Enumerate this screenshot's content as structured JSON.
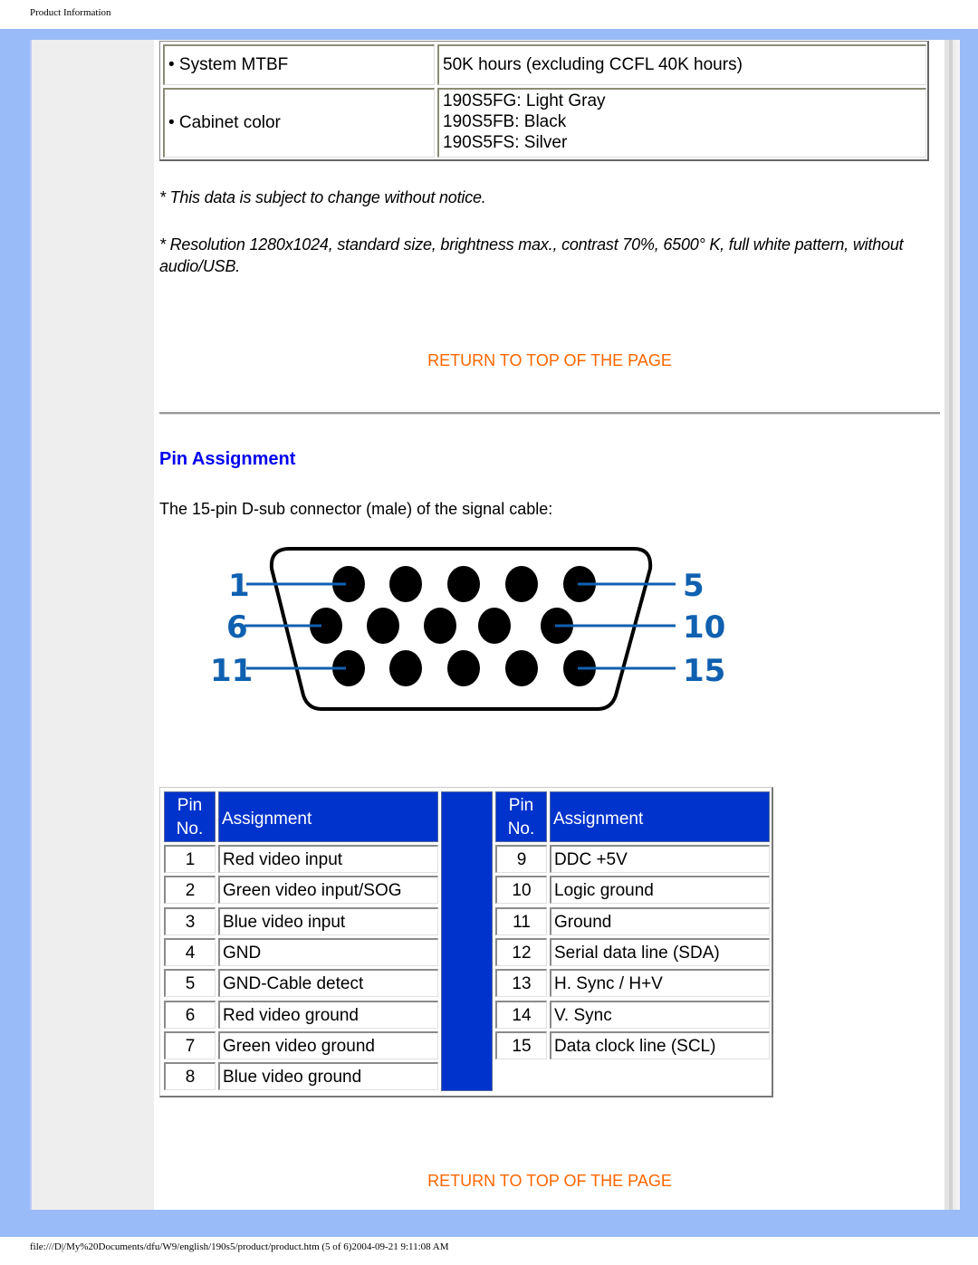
{
  "print_header": "Product Information",
  "spec_rows": [
    {
      "label": "• System MTBF",
      "value_lines": [
        "50K hours (excluding CCFL 40K hours)"
      ]
    },
    {
      "label": "• Cabinet color",
      "value_lines": [
        "190S5FG: Light Gray",
        "190S5FB: Black",
        "190S5FS: Silver"
      ]
    }
  ],
  "notes": [
    "* This data is subject to change without notice.",
    "* Resolution 1280x1024, standard size, brightness max., contrast 70%, 6500° K, full white pattern, without audio/USB."
  ],
  "return_link_label": "RETURN TO TOP OF THE PAGE",
  "pin_section": {
    "title": "Pin Assignment",
    "intro": "The 15-pin D-sub connector (male) of the signal cable:",
    "diagram_labels": {
      "pin1": "1",
      "pin5": "5",
      "pin6": "6",
      "pin10": "10",
      "pin11": "11",
      "pin15": "15"
    },
    "table_header": {
      "pin_line1": "Pin",
      "pin_line2": "No.",
      "assignment": "Assignment"
    },
    "left_pins": [
      {
        "no": "1",
        "assignment": "Red video input"
      },
      {
        "no": "2",
        "assignment": "Green video input/SOG"
      },
      {
        "no": "3",
        "assignment": "Blue video input"
      },
      {
        "no": "4",
        "assignment": "GND"
      },
      {
        "no": "5",
        "assignment": "GND-Cable detect"
      },
      {
        "no": "6",
        "assignment": "Red video ground"
      },
      {
        "no": "7",
        "assignment": "Green video ground"
      },
      {
        "no": "8",
        "assignment": "Blue video ground"
      }
    ],
    "right_pins": [
      {
        "no": "9",
        "assignment": "DDC +5V"
      },
      {
        "no": "10",
        "assignment": "Logic ground"
      },
      {
        "no": "11",
        "assignment": "Ground"
      },
      {
        "no": "12",
        "assignment": "Serial data line (SDA)"
      },
      {
        "no": "13",
        "assignment": "H. Sync / H+V"
      },
      {
        "no": "14",
        "assignment": "V. Sync"
      },
      {
        "no": "15",
        "assignment": "Data clock line (SCL)"
      }
    ]
  },
  "print_footer": "file:///D|/My%20Documents/dfu/W9/english/190s5/product/product.htm (5 of 6)2004-09-21 9:11:08 AM",
  "colors": {
    "frame": "#99bbf7",
    "link": "#ff6600",
    "heading": "#0000ee",
    "table_header": "#0033cc",
    "diagram_label": "#1060b0"
  }
}
